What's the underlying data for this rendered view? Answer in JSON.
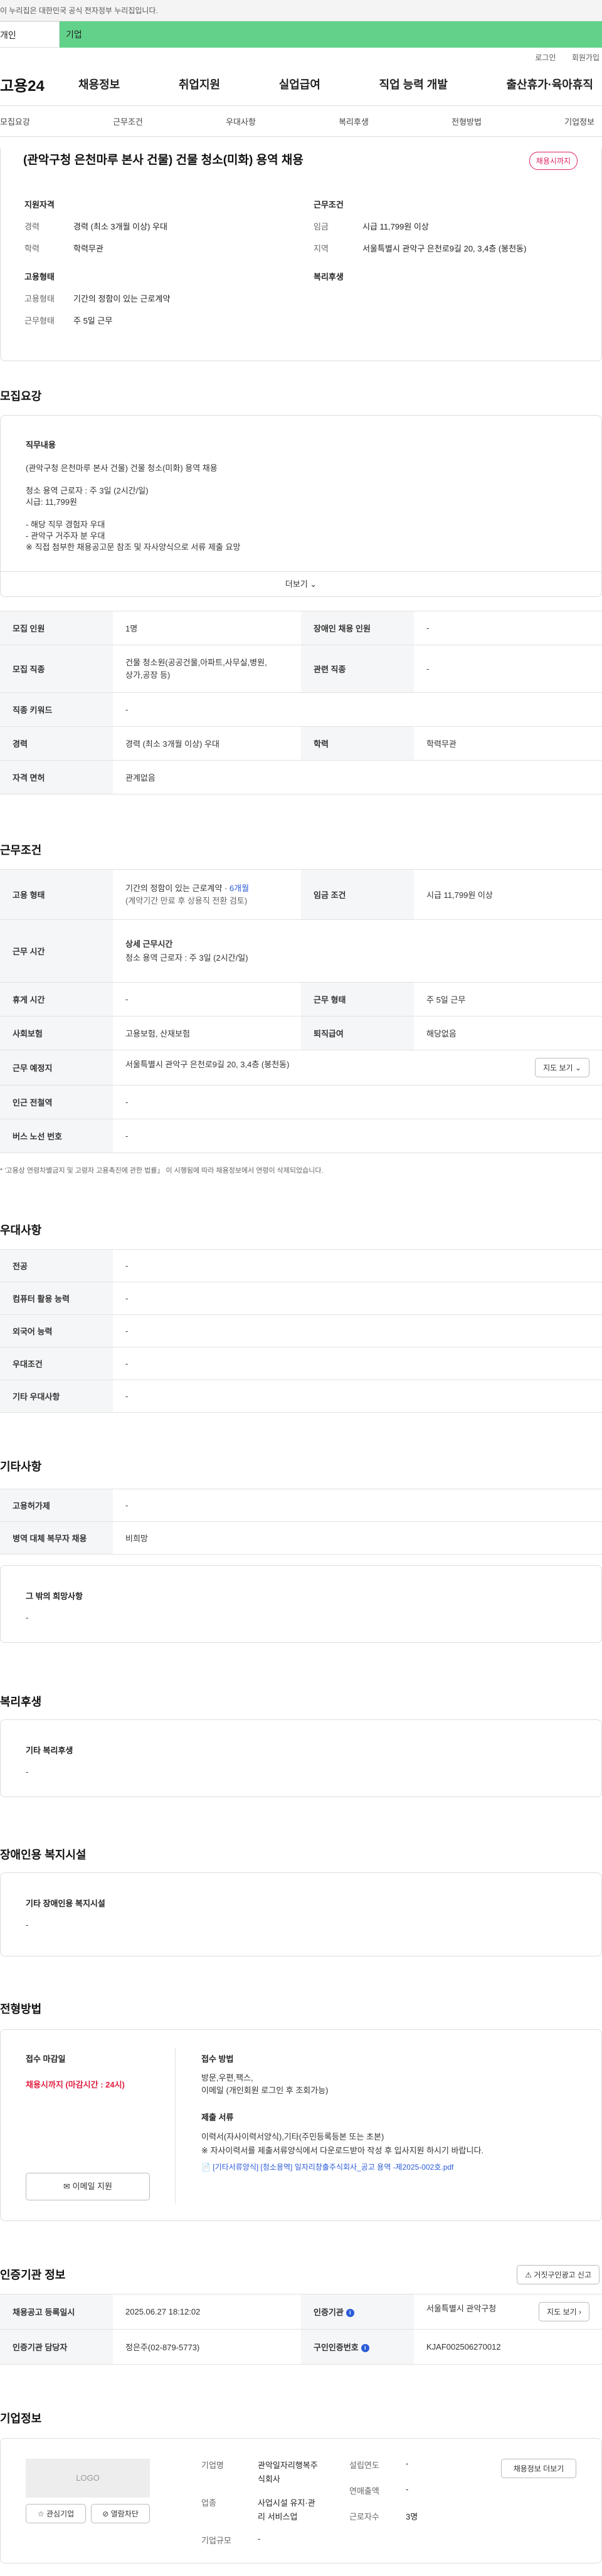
{
  "gov_bar": "이 누리집은 대한민국 공식 전자정부 누리집입니다.",
  "persona_tabs": [
    "개인",
    "기업"
  ],
  "util_links": [
    "로그인",
    "회원가입"
  ],
  "logo": "고용24",
  "gnb": [
    "채용정보",
    "취업지원",
    "실업급여",
    "직업 능력 개발",
    "출산휴가·육아휴직"
  ],
  "lnb": [
    "모집요강",
    "근무조건",
    "우대사항",
    "복리후생",
    "전형방법",
    "기업정보"
  ],
  "summary": {
    "title": "(관악구청 은천마루 본사 건물) 건물 청소(미화) 용역 채용",
    "badge": "채용시까지",
    "qual_title": "지원자격",
    "cond_title": "근무조건",
    "type_title": "고용형태",
    "welfare_title": "복리후생",
    "career_k": "경력",
    "career_v": "경력 (최소 3개월 이상) 우대",
    "edu_k": "학력",
    "edu_v": "학력무관",
    "wage_k": "임금",
    "wage_v": "시급 11,799원 이상",
    "region_k": "지역",
    "region_v": "서울특별시 관악구 은천로9길 20, 3,4층 (봉천동)",
    "emp_k": "고용형태",
    "emp_v": "기간의 정함이 있는 근로계약",
    "work_k": "근무형태",
    "work_v": "주 5일 근무"
  },
  "recruit": {
    "title": "모집요강",
    "detail_label": "직무내용",
    "detail_text": "(관악구청 은천마루 본사 건물) 건물 청소(미화) 용역 채용\n\n청소 용역 근로자 : 주 3일 (2시간/일)\n시급: 11,799원\n\n- 해당 직무 경험자 우대\n- 관악구 거주자 분 우대\n※ 직접 첨부한 채용공고문 참조 및 자사양식으로 서류 제출 요망",
    "more": "더보기",
    "rows": [
      {
        "k1": "모집 인원",
        "v1": "1명",
        "k2": "장애인 채용 인원",
        "v2": "-"
      },
      {
        "k1": "모집 직종",
        "v1": "건물 청소원(공공건물,아파트,사무실,병원,\n상가,공장 등)",
        "k2": "관련 직종",
        "v2": "-"
      },
      {
        "k1": "직종 키워드",
        "v1": "-"
      },
      {
        "k1": "경력",
        "v1": "경력 (최소 3개월 이상) 우대",
        "k2": "학력",
        "v2": "학력무관"
      },
      {
        "k1": "자격 면허",
        "v1": "관계없음"
      }
    ]
  },
  "work": {
    "title": "근무조건",
    "emp_k": "고용 형태",
    "emp_v1": "기간의 정함이 있는 근로계약 · ",
    "emp_v1b": "6개월",
    "emp_v2": "(계약기간 만료 후 상용직 전환 검토)",
    "wage_k": "임금 조건",
    "wage_v": "시급 11,799원 이상",
    "time_k": "근무 시간",
    "time_h": "상세 근무시간",
    "time_v": "청소 용역 근로자 : 주 3일 (2시간/일)",
    "rest_k": "휴게 시간",
    "rest_v": "-",
    "shape_k": "근무 형태",
    "shape_v": "주 5일 근무",
    "ins_k": "사회보험",
    "ins_v": "고용보험, 산재보험",
    "ret_k": "퇴직급여",
    "ret_v": "해당없음",
    "place_k": "근무 예정지",
    "place_v": "서울특별시 관악구 은천로9길 20, 3,4층 (봉천동)",
    "map_btn": "지도 보기",
    "sub_k": "인근 전철역",
    "sub_v": "-",
    "bus_k": "버스 노선 번호",
    "bus_v": "-",
    "note": "* '고용상 연령차별금지 및 고령자 고용촉진에 관한 법률」 이 시행됨에 따라 채용정보에서 연령이 삭제되었습니다."
  },
  "pref": {
    "title": "우대사항",
    "rows": [
      [
        "전공",
        "-"
      ],
      [
        "컴퓨터 활용 능력",
        "-"
      ],
      [
        "외국어 능력",
        "-"
      ],
      [
        "우대조건",
        "-"
      ],
      [
        "기타 우대사항",
        "-"
      ]
    ]
  },
  "etc": {
    "title": "기타사항",
    "rows": [
      [
        "고용허가제",
        "-"
      ],
      [
        "병역 대체 복무자 채용",
        "비희망"
      ]
    ],
    "card_label": "그 밖의 희망사항",
    "card_val": "-"
  },
  "welfare": {
    "title": "복리후생",
    "label": "기타 복리후생",
    "val": "-"
  },
  "disabled": {
    "title": "장애인용 복지시설",
    "label": "기타 장애인용 복지시설",
    "val": "-"
  },
  "process": {
    "title": "전형방법",
    "deadline_label": "접수 마감일",
    "deadline_val": "채용시까지 (마감시간 : 24시)",
    "method_label": "접수 방법",
    "method_val": "방문,우편,팩스,\n이메일 (개인회원 로그인 후 조회가능)",
    "docs_label": "제출 서류",
    "docs_val": "이력서(자사이력서양식),기타(주민등록등본 또는 초본)\n※ 자사이력서를 제출서류양식에서 다운로드받아 작성 후 입사지원 하시기 바랍니다.",
    "file": "[기타서류양식] [청소용역] 일자리창출주식회사_공고 용역 -제2025-002호.pdf",
    "apply_btn": "이메일 지원"
  },
  "auth": {
    "title": "인증기관 정보",
    "report_btn": "거짓구인광고 신고",
    "reg_k": "채용공고 등록일시",
    "reg_v": "2025.06.27 18:12:02",
    "org_k": "인증기관",
    "org_v": "서울특별시 관악구청",
    "map_btn": "지도 보기",
    "mgr_k": "인증기관 담당자",
    "mgr_v": "정은주(02-879-5773)",
    "no_k": "구인인증번호",
    "no_v": "KJAF002506270012"
  },
  "company": {
    "title": "기업정보",
    "logo": "LOGO",
    "fav_btn": "관심기업",
    "block_btn": "열람차단",
    "name_k": "기업명",
    "name_v": "관악일자리행복주\n식회사",
    "ind_k": "업종",
    "ind_v": "사업시설 유지·관\n리 서비스업",
    "size_k": "기업규모",
    "size_v": "-",
    "est_k": "설립연도",
    "est_v": "-",
    "rev_k": "연매출액",
    "rev_v": "-",
    "emp_k": "근로자수",
    "emp_v": "3명",
    "jobs_btn": "채용정보 더보기"
  }
}
